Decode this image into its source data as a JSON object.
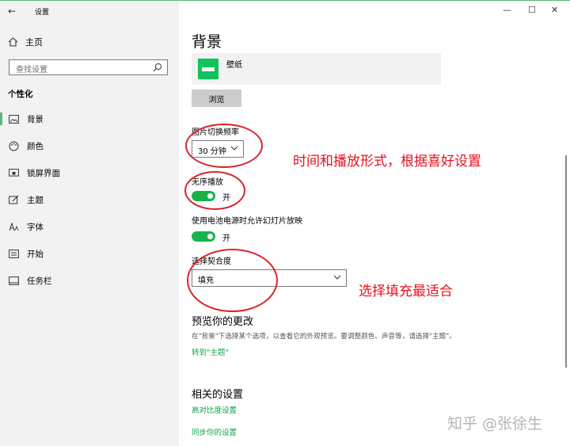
{
  "window": {
    "title": "设置",
    "back_glyph": "←",
    "minimize_glyph": "—",
    "maximize_glyph": "☐",
    "close_glyph": "✕"
  },
  "sidebar": {
    "home_label": "主页",
    "search_placeholder": "查找设置",
    "section_title": "个性化",
    "items": [
      {
        "label": "背景",
        "icon": "picture-icon",
        "active": true
      },
      {
        "label": "颜色",
        "icon": "palette-icon",
        "active": false
      },
      {
        "label": "锁屏界面",
        "icon": "lock-screen-icon",
        "active": false
      },
      {
        "label": "主题",
        "icon": "theme-icon",
        "active": false
      },
      {
        "label": "字体",
        "icon": "font-icon",
        "active": false
      },
      {
        "label": "开始",
        "icon": "start-icon",
        "active": false
      },
      {
        "label": "任务栏",
        "icon": "taskbar-icon",
        "active": false
      }
    ]
  },
  "main": {
    "title": "背景",
    "wallpaper_label": "壁纸",
    "browse_label": "浏览",
    "interval_label": "图片切换频率",
    "interval_value": "30 分钟",
    "shuffle_label": "无序播放",
    "shuffle_state": "开",
    "battery_label": "使用电池电源时允许幻灯片放映",
    "battery_state": "开",
    "fit_label": "选择契合度",
    "fit_value": "填充",
    "preview_title": "预览你的更改",
    "preview_desc": "在\"背景\"下选择某个选项，以查看它的外观预览。要调整颜色、声音等，请选择\"主题\"。",
    "preview_link": "转到\"主题\"",
    "related_title": "相关的设置",
    "related_links": [
      "高对比度设置",
      "同步你的设置"
    ]
  },
  "annotations": {
    "note1": "时间和播放形式，根据喜好设置",
    "note2": "选择填充最适合",
    "color": "#e8101e"
  },
  "watermark": "知乎 @张徐生",
  "colors": {
    "accent": "#19b24a",
    "link": "#10a34a",
    "sidebar_bg": "#f2f2f2"
  }
}
